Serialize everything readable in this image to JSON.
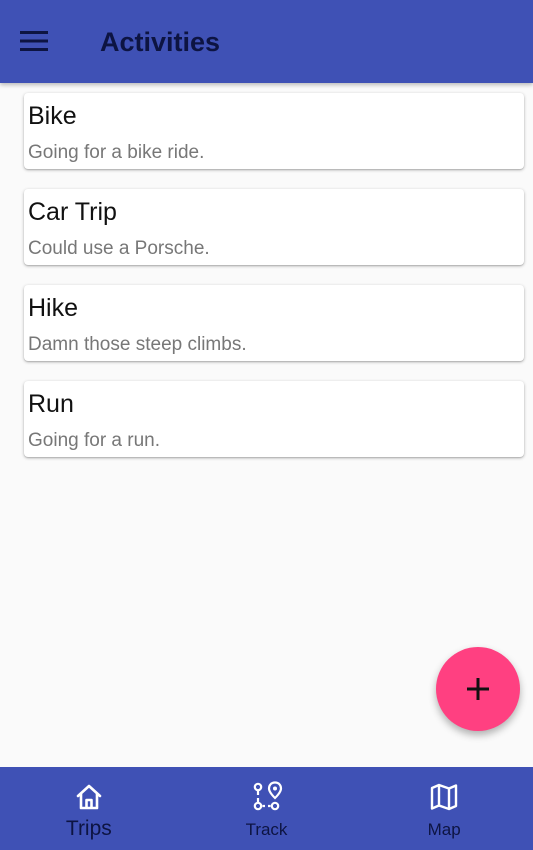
{
  "app_bar": {
    "title": "Activities",
    "menu_icon": "menu-icon"
  },
  "activities": [
    {
      "title": "Bike",
      "subtitle": "Going for a bike ride."
    },
    {
      "title": "Car Trip",
      "subtitle": "Could use a Porsche."
    },
    {
      "title": "Hike",
      "subtitle": "Damn those steep climbs."
    },
    {
      "title": "Run",
      "subtitle": "Going for a run."
    }
  ],
  "fab": {
    "icon": "add-icon"
  },
  "bottom_nav": {
    "items": [
      {
        "label": "Trips",
        "icon": "home-icon",
        "active": true
      },
      {
        "label": "Track",
        "icon": "route-icon",
        "active": false
      },
      {
        "label": "Map",
        "icon": "map-icon",
        "active": false
      }
    ]
  },
  "colors": {
    "primary": "#3f51b5",
    "accent": "#ff4081",
    "on_primary": "#0d1442",
    "background": "#fafafa"
  }
}
